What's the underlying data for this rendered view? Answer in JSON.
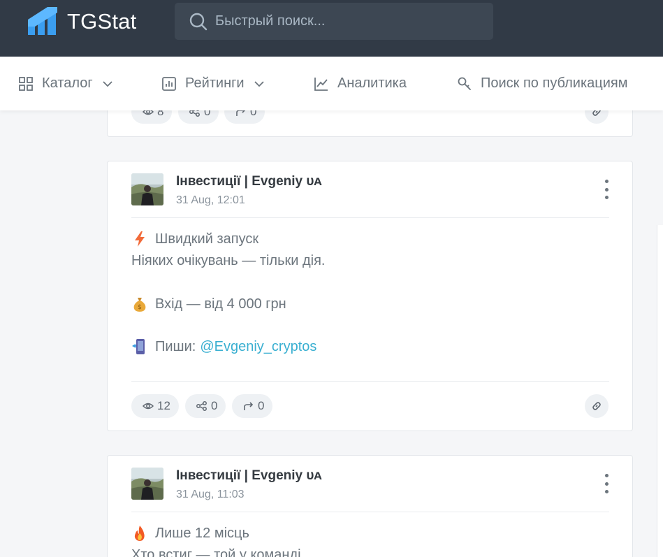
{
  "header": {
    "brand": "TGStat",
    "search_placeholder": "Быстрый поиск..."
  },
  "nav": {
    "items": [
      {
        "label": "Каталог",
        "icon": "grid-icon",
        "has_dropdown": true
      },
      {
        "label": "Рейтинги",
        "icon": "bar-chart-icon",
        "has_dropdown": true
      },
      {
        "label": "Аналитика",
        "icon": "line-chart-icon",
        "has_dropdown": false
      },
      {
        "label": "Поиск по публикациям",
        "icon": "key-search-icon",
        "has_dropdown": false
      }
    ]
  },
  "posts": [
    {
      "stats": {
        "views": "8",
        "shares": "0",
        "forwards": "0"
      }
    },
    {
      "channel": "Інвестиції | Evgeniy ᴜᴀ",
      "date": "31 Aug, 12:01",
      "lines": [
        {
          "emoji": "lightning-emoji",
          "text": "Швидкий запуск"
        },
        {
          "text": "Ніяких очікувань — тільки дія."
        },
        {
          "emoji": "money-bag-emoji",
          "text": "Вхід — від 4 000 грн"
        },
        {
          "emoji": "phone-emoji",
          "text": "Пиши:",
          "mention": "@Evgeniy_cryptos"
        }
      ],
      "stats": {
        "views": "12",
        "shares": "0",
        "forwards": "0"
      }
    },
    {
      "channel": "Інвестиції | Evgeniy ᴜᴀ",
      "date": "31 Aug, 11:03",
      "lines": [
        {
          "emoji": "fire-emoji",
          "text": "Лише 12 місць"
        },
        {
          "text": "Хто встиг — той у команді."
        }
      ]
    }
  ],
  "colors": {
    "topbar": "#313a46",
    "accent": "#39afd1",
    "logo_blue": "#3b9ef0"
  }
}
